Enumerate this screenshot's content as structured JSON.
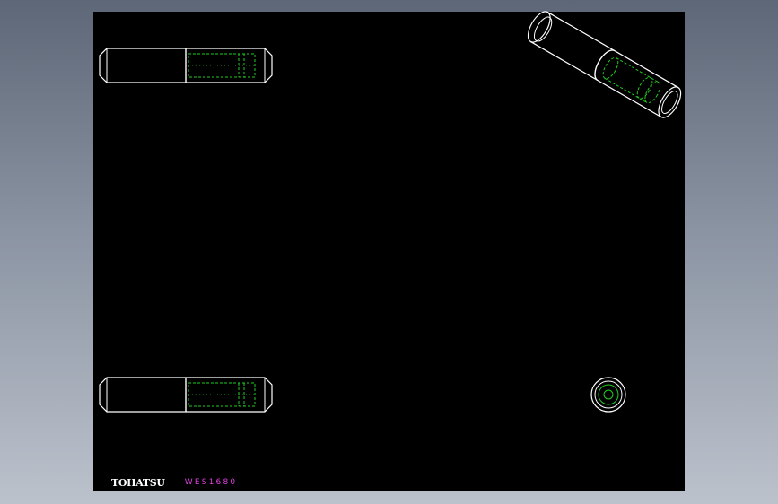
{
  "titleblock": {
    "brand": "TOHATSU",
    "drawing_code": "WES1680"
  },
  "colors": {
    "background": "#000000",
    "outline": "#ffffff",
    "hidden_line": "#22cc22",
    "brand": "#ffffff",
    "drawing_code": "#e040e0"
  },
  "icons": {
    "pin_front_top": "dowel-pin-side-view",
    "pin_front_bottom": "dowel-pin-side-view",
    "pin_isometric": "dowel-pin-isometric-view",
    "pin_end": "dowel-pin-end-view"
  }
}
